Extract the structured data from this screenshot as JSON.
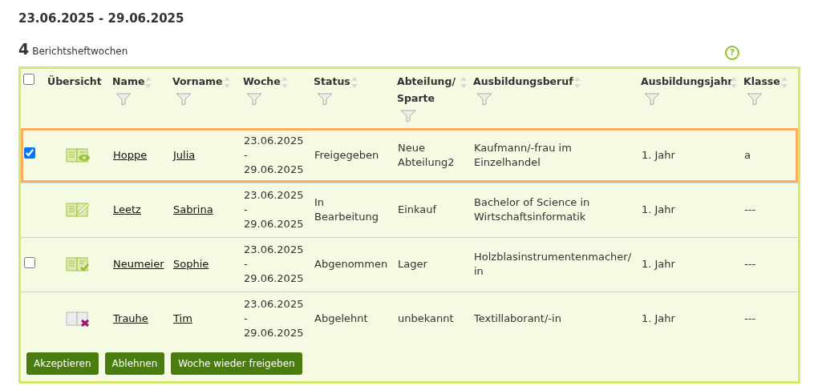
{
  "title": "23.06.2025 - 29.06.2025",
  "count": {
    "value": "4",
    "label": "Berichtsheftwochen"
  },
  "help": {
    "symbol": "?"
  },
  "table": {
    "select_all": {
      "checked": false
    },
    "columns": [
      {
        "label": "Übersicht",
        "sortable": false,
        "filter": false
      },
      {
        "label": "Name",
        "sortable": true,
        "filter": true
      },
      {
        "label": "Vorname",
        "sortable": true,
        "filter": true
      },
      {
        "label": "Woche",
        "sortable": true,
        "filter": true
      },
      {
        "label": "Status",
        "sortable": true,
        "filter": true
      },
      {
        "label": "Abteilung/ Sparte",
        "sortable": true,
        "filter": true
      },
      {
        "label": "Ausbildungsberuf",
        "sortable": true,
        "filter": true
      },
      {
        "label": "Ausbildungsjahr",
        "sortable": true,
        "filter": true
      },
      {
        "label": "Klasse",
        "sortable": true,
        "filter": true
      }
    ],
    "rows": [
      {
        "selected": true,
        "has_checkbox": true,
        "checked": true,
        "kind": "view",
        "name": "Hoppe",
        "vorname": "Julia",
        "woche_start": "23.06.2025",
        "woche_sep": "-",
        "woche_end": "29.06.2025",
        "status": "Freigegeben",
        "abteilung": "Neue Abteilung2",
        "beruf": "Kaufmann/-frau im Einzelhandel",
        "jahr": "1. Jahr",
        "klasse": "a"
      },
      {
        "selected": false,
        "has_checkbox": false,
        "kind": "edit",
        "name": "Leetz",
        "vorname": "Sabrina",
        "woche_start": "23.06.2025",
        "woche_sep": "-",
        "woche_end": "29.06.2025",
        "status": "In Bearbeitung",
        "abteilung": "Einkauf",
        "beruf": "Bachelor of Science in Wirtschaftsinformatik",
        "jahr": "1. Jahr",
        "klasse": "---"
      },
      {
        "selected": false,
        "has_checkbox": true,
        "checked": false,
        "kind": "approved",
        "name": "Neumeier",
        "vorname": "Sophie",
        "woche_start": "23.06.2025",
        "woche_sep": "-",
        "woche_end": "29.06.2025",
        "status": "Abgenommen",
        "abteilung": "Lager",
        "beruf": "Holzblasinstrumentenmacher/ in",
        "jahr": "1. Jahr",
        "klasse": "---"
      },
      {
        "selected": false,
        "has_checkbox": false,
        "kind": "rejected",
        "name": "Trauhe",
        "vorname": "Tim",
        "woche_start": "23.06.2025",
        "woche_sep": "-",
        "woche_end": "29.06.2025",
        "status": "Abgelehnt",
        "abteilung": "unbekannt",
        "beruf": "Textillaborant/-in",
        "jahr": "1. Jahr",
        "klasse": "---"
      }
    ]
  },
  "buttons": [
    "Akzeptieren",
    "Ablehnen",
    "Woche wieder freigeben"
  ]
}
